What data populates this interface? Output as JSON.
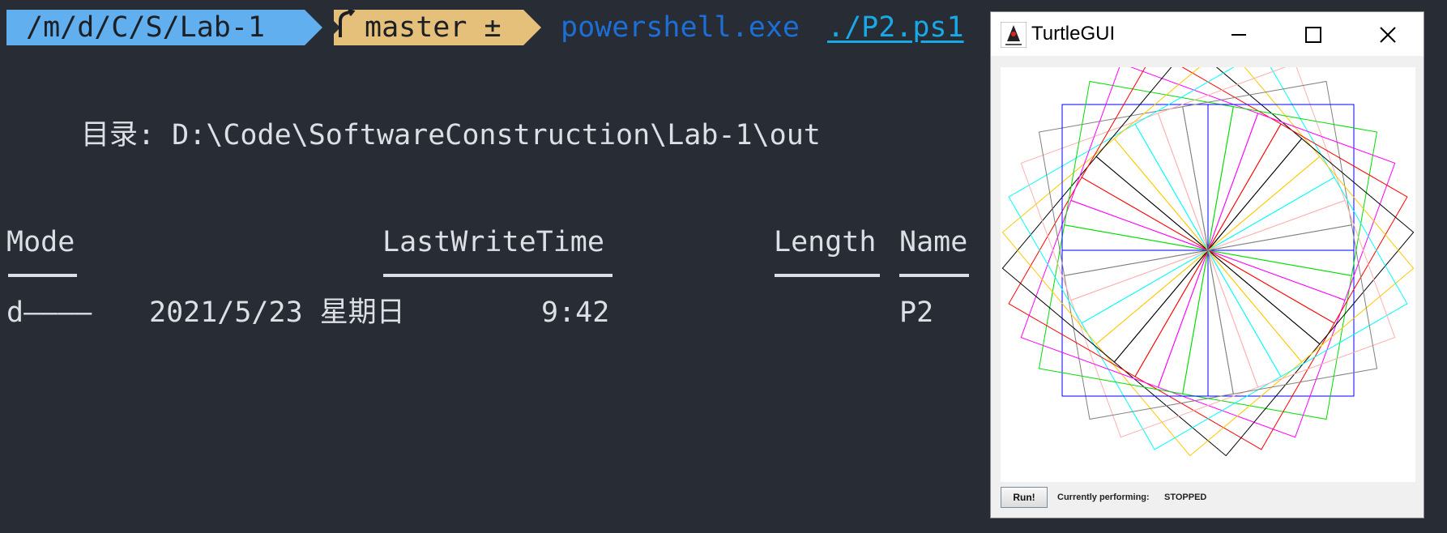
{
  "terminal": {
    "prompt": {
      "path": "/m/d/C/S/Lab-1",
      "branch": "master ±",
      "command": "powershell.exe",
      "argument": "./P2.ps1",
      "colors": {
        "path_bg": "#61afef",
        "git_bg": "#e5c07b",
        "command": "#1c6fd6",
        "argument": "#19a9e6"
      }
    },
    "directory_line": "目录: D:\\Code\\SoftwareConstruction\\Lab-1\\out",
    "table": {
      "headers": {
        "mode": "Mode",
        "last_write_time": "LastWriteTime",
        "length": "Length",
        "name": "Name"
      },
      "rows": [
        {
          "mode": "d————",
          "date": "2021/5/23 星期日",
          "time": "9:42",
          "length": "",
          "name": "P2"
        }
      ]
    }
  },
  "turtle_window": {
    "title": "TurtleGUI",
    "icon": "java-duke-icon",
    "controls": [
      "minimize-icon",
      "maximize-icon",
      "close-icon"
    ],
    "run_button": "Run!",
    "status_label": "Currently performing:",
    "status_value": "STOPPED",
    "drawing": {
      "shape": "square",
      "count": 36,
      "rotation_step_degrees": 10,
      "colors": [
        "#0000ff",
        "#00dd00",
        "#ff00ff",
        "#ff0000",
        "#000000",
        "#ffc800",
        "#00ffff",
        "#ffafaf",
        "#808080"
      ]
    }
  }
}
